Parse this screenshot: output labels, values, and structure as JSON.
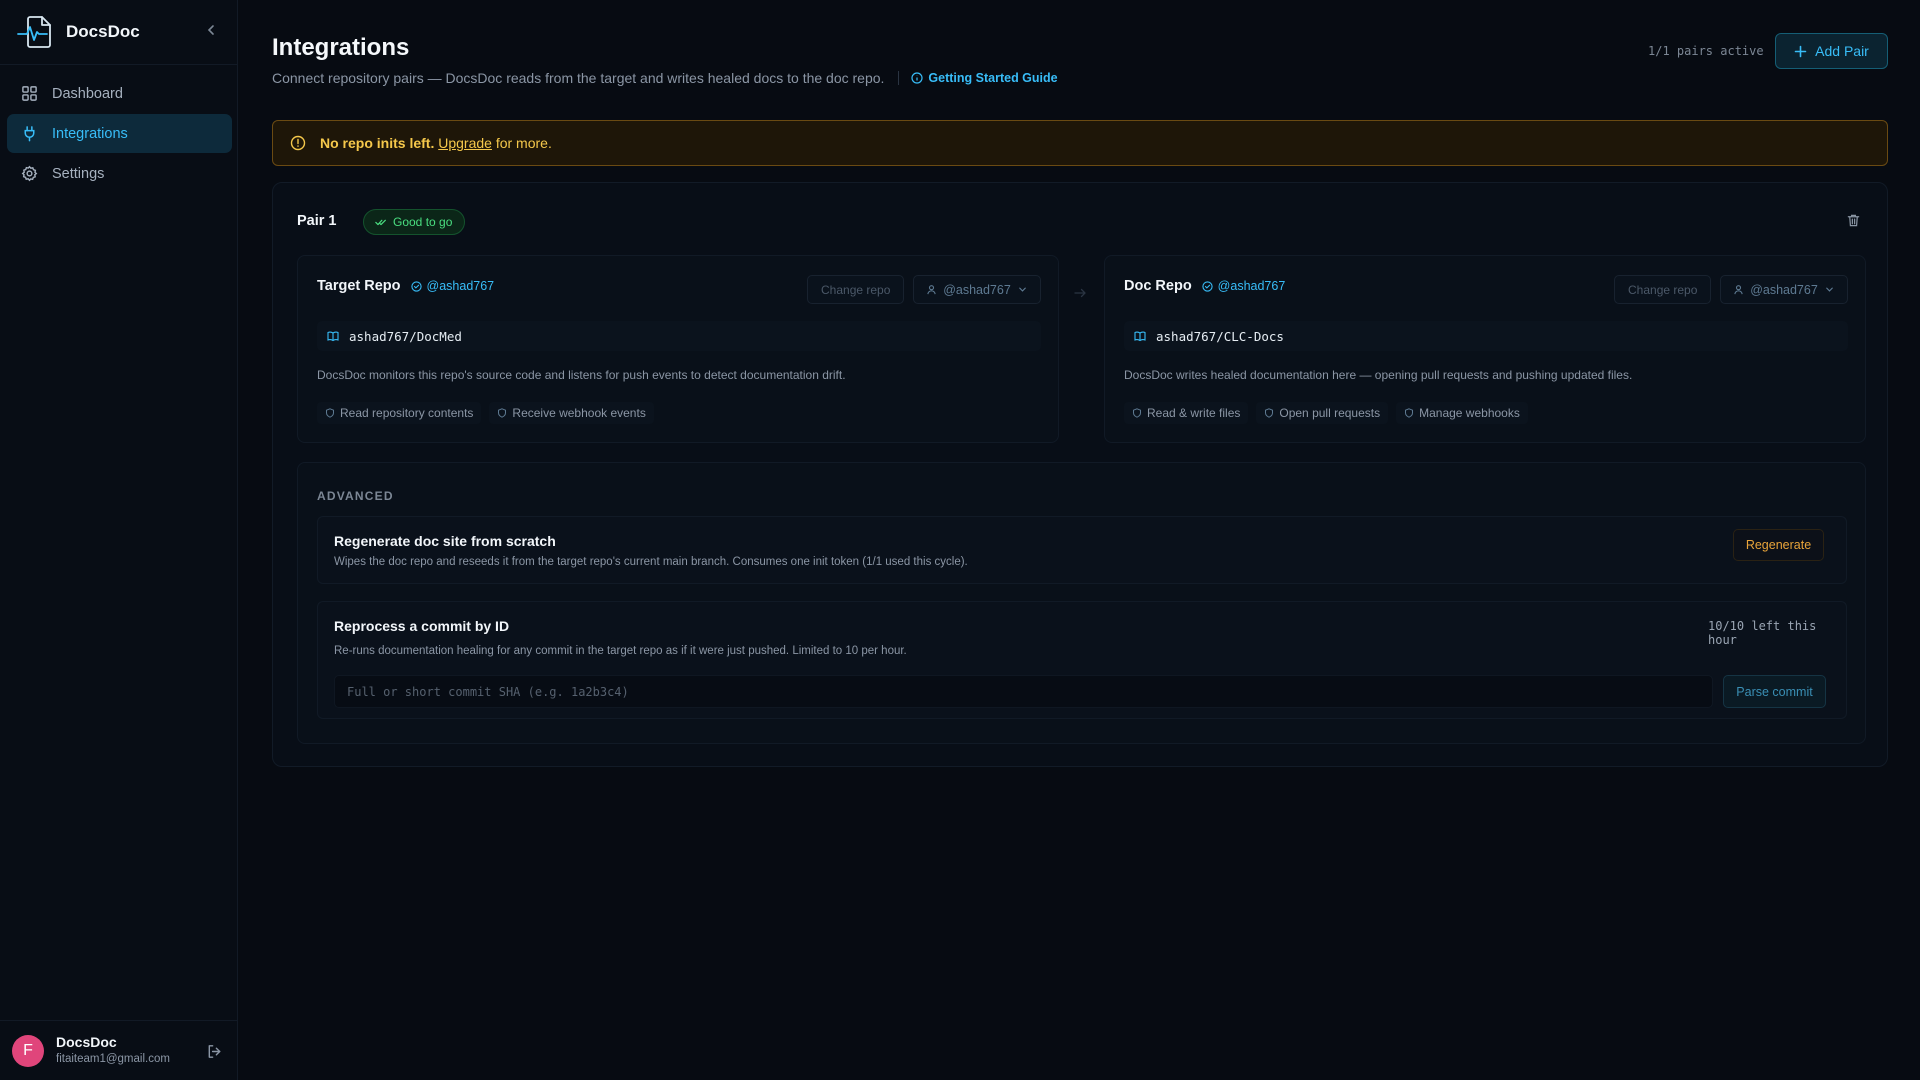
{
  "app": {
    "name": "DocsDoc"
  },
  "sidebar": {
    "items": [
      {
        "label": "Dashboard",
        "icon": "grid-icon",
        "active": false
      },
      {
        "label": "Integrations",
        "icon": "plug-icon",
        "active": true
      },
      {
        "label": "Settings",
        "icon": "gear-icon",
        "active": false
      }
    ],
    "user": {
      "initial": "F",
      "name": "DocsDoc",
      "email": "fitaiteam1@gmail.com"
    }
  },
  "header": {
    "title": "Integrations",
    "subtitle": "Connect repository pairs — DocsDoc reads from the target and writes healed docs to the doc repo.",
    "guide_link": "Getting Started Guide",
    "pairs_active": "1/1 pairs active",
    "add_pair_label": "Add Pair"
  },
  "banner": {
    "bold_text": "No repo inits left.",
    "link_text": "Upgrade",
    "rest_text": "for more."
  },
  "pair": {
    "title": "Pair 1",
    "status": "Good to go",
    "target": {
      "title": "Target Repo",
      "owner": "@ashad767",
      "change_label": "Change repo",
      "account_label": "@ashad767",
      "repo": "ashad767/DocMed",
      "description": "DocsDoc monitors this repo's source code and listens for push events to detect documentation drift.",
      "permissions": [
        "Read repository contents",
        "Receive webhook events"
      ]
    },
    "doc": {
      "title": "Doc Repo",
      "owner": "@ashad767",
      "change_label": "Change repo",
      "account_label": "@ashad767",
      "repo": "ashad767/CLC-Docs",
      "description": "DocsDoc writes healed documentation here — opening pull requests and pushing updated files.",
      "permissions": [
        "Read & write files",
        "Open pull requests",
        "Manage webhooks"
      ]
    }
  },
  "advanced": {
    "label": "ADVANCED",
    "regenerate": {
      "title": "Regenerate doc site from scratch",
      "description": "Wipes the doc repo and reseeds it from the target repo's current main branch. Consumes one init token (1/1 used this cycle).",
      "button": "Regenerate"
    },
    "reprocess": {
      "title": "Reprocess a commit by ID",
      "description": "Re-runs documentation healing for any commit in the target repo as if it were just pushed. Limited to 10 per hour.",
      "remaining": "10/10 left this hour",
      "input_placeholder": "Full or short commit SHA (e.g. 1a2b3c4)",
      "input_value": "",
      "button": "Parse commit"
    }
  },
  "colors": {
    "accent": "#38bdf8",
    "success": "#4ade80",
    "warning": "#f5c84b",
    "regen": "#e8a43a",
    "avatar": "#e0457b"
  }
}
